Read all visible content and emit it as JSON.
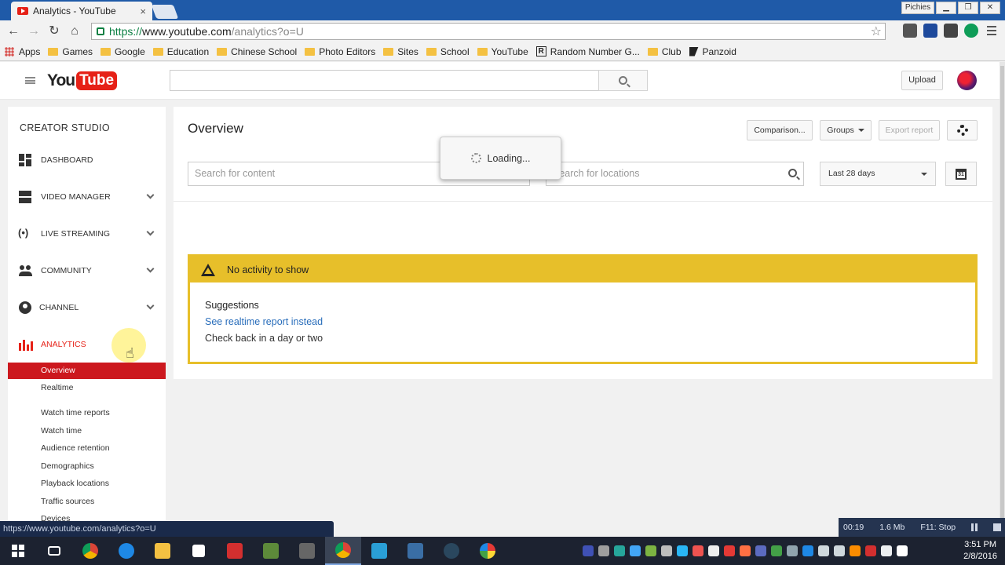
{
  "browser": {
    "tab_title": "Analytics - YouTube",
    "tab_close": "×",
    "profile_label": "Pichies",
    "url_scheme": "https://",
    "url_host": "www.youtube.com",
    "url_path": "/analytics?o=U",
    "status_url": "https://www.youtube.com/analytics?o=U"
  },
  "bookmarks": {
    "apps": "Apps",
    "items": [
      "Games",
      "Google",
      "Education",
      "Chinese School",
      "Photo Editors",
      "Sites",
      "School",
      "YouTube"
    ],
    "random_number": "Random Number G...",
    "club": "Club",
    "panzoid": "Panzoid"
  },
  "header": {
    "logo_you": "You",
    "logo_tube": "Tube",
    "search_placeholder": "",
    "upload_label": "Upload"
  },
  "sidebar": {
    "title": "CREATOR STUDIO",
    "items": [
      {
        "label": "DASHBOARD"
      },
      {
        "label": "VIDEO MANAGER"
      },
      {
        "label": "LIVE STREAMING"
      },
      {
        "label": "COMMUNITY"
      },
      {
        "label": "CHANNEL"
      },
      {
        "label": "ANALYTICS"
      }
    ],
    "sub_items": [
      "Overview",
      "Realtime",
      "Watch time reports",
      "Watch time",
      "Audience retention",
      "Demographics",
      "Playback locations",
      "Traffic sources",
      "Devices"
    ]
  },
  "main": {
    "title": "Overview",
    "comparison_label": "Comparison...",
    "groups_label": "Groups",
    "export_label": "Export report",
    "content_search_placeholder": "Search for content",
    "location_search_placeholder": "Search for locations",
    "date_range": "Last 28 days",
    "calendar_day": "31",
    "loading_text": "Loading...",
    "alert": {
      "heading": "No activity to show",
      "suggestions_title": "Suggestions",
      "link": "See realtime report instead",
      "text": "Check back in a day or two"
    }
  },
  "recorder": {
    "time": "00:19",
    "size": "1.6 Mb",
    "stop_label": "F11: Stop"
  },
  "taskbar": {
    "clock_time": "3:51 PM",
    "clock_date": "2/8/2016"
  },
  "colors": {
    "brand_red": "#e62117",
    "alert_yellow": "#e7bf2a",
    "link_blue": "#2a6ebb",
    "chrome_blue": "#1f5aa8"
  }
}
